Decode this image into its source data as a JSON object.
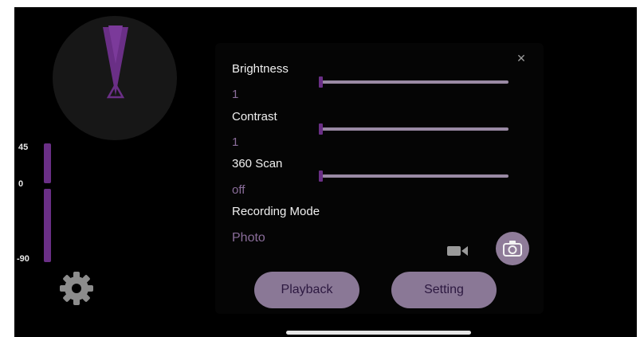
{
  "colors": {
    "accent": "#6a2f86",
    "value_text": "#8a6d9a",
    "button_bg": "#8a7896",
    "button_text": "#2c1840",
    "background": "#000000"
  },
  "radar": {
    "icon": "radar-sweep"
  },
  "tilt_scale": {
    "labels": [
      "45",
      "0",
      "-90"
    ]
  },
  "settings": {
    "brightness": {
      "label": "Brightness",
      "value": "1"
    },
    "contrast": {
      "label": "Contrast",
      "value": "1"
    },
    "scan360": {
      "label": "360 Scan",
      "value": "off"
    },
    "recording_mode": {
      "label": "Recording Mode",
      "value": "Photo"
    }
  },
  "icons": {
    "close": "close-icon",
    "gear": "gear-icon",
    "video": "video-camera-icon",
    "camera": "camera-icon"
  },
  "buttons": {
    "playback": "Playback",
    "setting": "Setting"
  },
  "close_glyph": "✕"
}
